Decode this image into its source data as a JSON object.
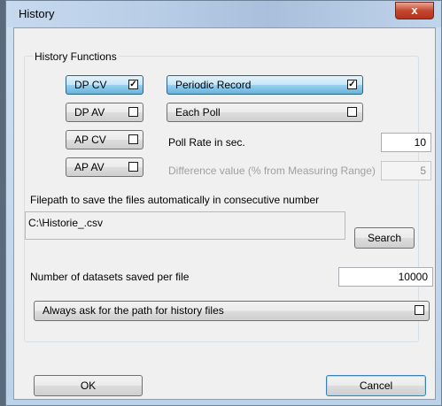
{
  "window": {
    "title": "History",
    "close_glyph": "x"
  },
  "group": {
    "legend": "History Functions"
  },
  "functions": {
    "dp_cv": {
      "label": "DP CV",
      "checked": true
    },
    "dp_av": {
      "label": "DP AV",
      "checked": false
    },
    "ap_cv": {
      "label": "AP CV",
      "checked": false
    },
    "ap_av": {
      "label": "AP AV",
      "checked": false
    },
    "periodic_record": {
      "label": "Periodic Record",
      "checked": true
    },
    "each_poll": {
      "label": "Each Poll",
      "checked": false
    }
  },
  "poll_rate": {
    "label": "Poll Rate in sec.",
    "value": "10"
  },
  "difference": {
    "label": "Difference value (% from Measuring Range)",
    "value": "5"
  },
  "filepath": {
    "label": "Filepath to save the files automatically in consecutive number",
    "value": "C:\\Historie_.csv",
    "search_label": "Search"
  },
  "datasets": {
    "label": "Number of datasets saved per file",
    "value": "10000"
  },
  "always_ask": {
    "label": "Always ask for the path for history files",
    "checked": false
  },
  "footer": {
    "ok_label": "OK",
    "cancel_label": "Cancel"
  },
  "icons": {
    "checkbox_checked": "checkmark-icon",
    "close": "close-icon"
  }
}
